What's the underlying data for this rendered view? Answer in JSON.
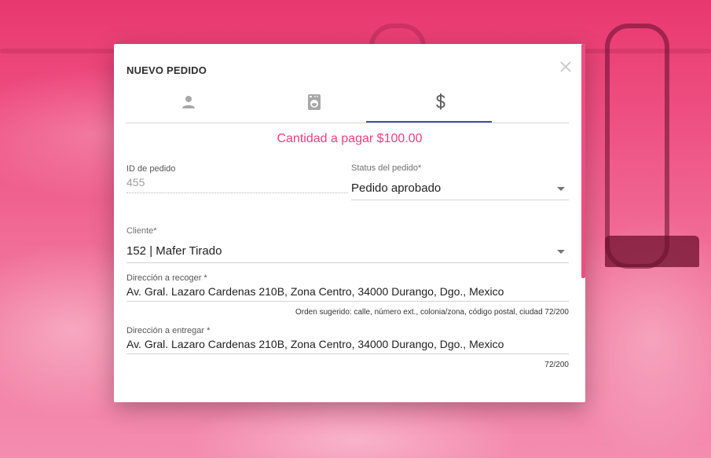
{
  "dialog": {
    "title": "NUEVO PEDIDO",
    "tabs": [
      {
        "icon": "person-icon"
      },
      {
        "icon": "washing-machine-icon"
      },
      {
        "icon": "dollar-icon",
        "active": true
      }
    ]
  },
  "summary": {
    "amount_text": "Cantidad a pagar $100.00"
  },
  "order": {
    "id_label": "ID de pedido",
    "id_value": "455",
    "status_label": "Status del pedido*",
    "status_value": "Pedido aprobado"
  },
  "client": {
    "label": "Cliente*",
    "value": "152 | Mafer Tirado"
  },
  "pickup": {
    "label": "Dirección a recoger *",
    "value": "Av. Gral. Lazaro Cardenas 210B, Zona Centro, 34000 Durango, Dgo., Mexico",
    "helper": "Orden sugerido: calle, número ext., colonia/zona, código postal, ciudad 72/200"
  },
  "delivery": {
    "label": "Dirección a entregar *",
    "value": "Av. Gral. Lazaro Cardenas 210B, Zona Centro, 34000 Durango, Dgo., Mexico",
    "counter": "72/200"
  },
  "colors": {
    "accent": "#ec407a",
    "tab_indicator": "#3f51b5",
    "background_pink": "#ee4f82"
  }
}
